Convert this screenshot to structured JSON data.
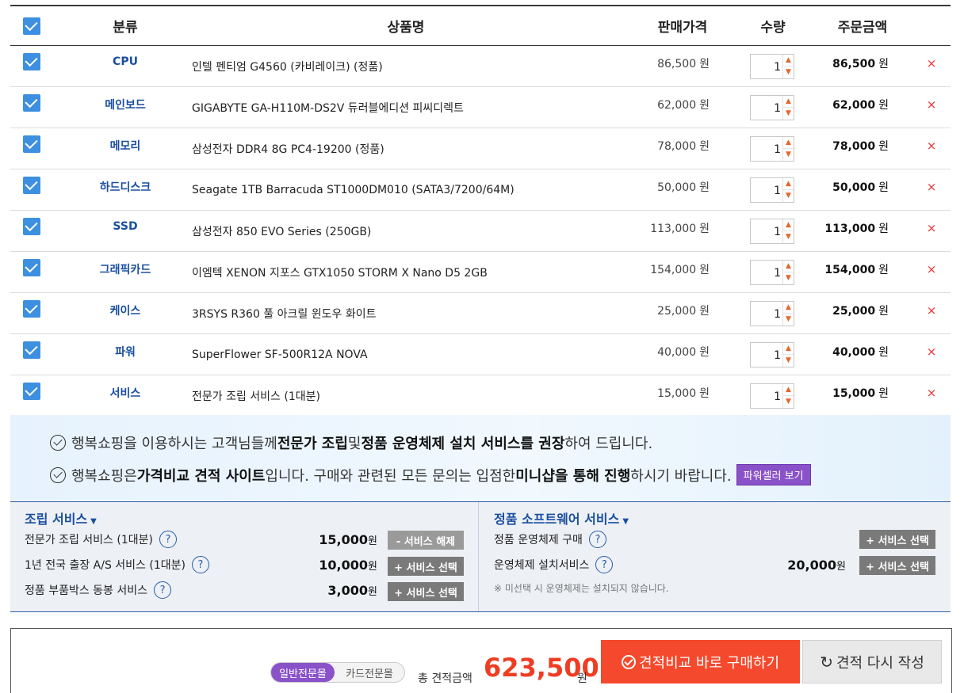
{
  "header": {
    "category": "분류",
    "product": "상품명",
    "price": "판매가격",
    "qty": "수량",
    "total": "주문금액"
  },
  "currency": "원",
  "items": [
    {
      "category": "CPU",
      "name": "인텔 펜티엄 G4560 (카비레이크) (정품)",
      "price": "86,500",
      "qty": "1",
      "total": "86,500"
    },
    {
      "category": "메인보드",
      "name": "GIGABYTE GA-H110M-DS2V 듀러블에디션 피씨디렉트",
      "price": "62,000",
      "qty": "1",
      "total": "62,000"
    },
    {
      "category": "메모리",
      "name": "삼성전자 DDR4 8G PC4-19200 (정품)",
      "price": "78,000",
      "qty": "1",
      "total": "78,000"
    },
    {
      "category": "하드디스크",
      "name": "Seagate 1TB Barracuda ST1000DM010 (SATA3/7200/64M)",
      "price": "50,000",
      "qty": "1",
      "total": "50,000"
    },
    {
      "category": "SSD",
      "name": "삼성전자 850 EVO Series (250GB)",
      "price": "113,000",
      "qty": "1",
      "total": "113,000"
    },
    {
      "category": "그래픽카드",
      "name": "이엠텍 XENON 지포스 GTX1050 STORM X Nano D5 2GB",
      "price": "154,000",
      "qty": "1",
      "total": "154,000"
    },
    {
      "category": "케이스",
      "name": "3RSYS R360 풀 아크릴 윈도우 화이트",
      "price": "25,000",
      "qty": "1",
      "total": "25,000"
    },
    {
      "category": "파워",
      "name": "SuperFlower SF-500R12A NOVA",
      "price": "40,000",
      "qty": "1",
      "total": "40,000"
    },
    {
      "category": "서비스",
      "name": "전문가 조립 서비스 (1대분)",
      "price": "15,000",
      "qty": "1",
      "total": "15,000"
    }
  ],
  "icons": {
    "check": "checkbox-checked-icon",
    "delete": "close-icon",
    "qty_up": "chevron-up-icon",
    "qty_down": "chevron-down-icon"
  },
  "delete_glyph": "×",
  "notice": {
    "line1": {
      "pre": "행복쇼핑을 이용하시는 고객님들께 ",
      "b1": "전문가 조립",
      "mid": " 및 ",
      "b2": "정품 운영체제 설치 서비스를 권장",
      "post": "하여 드립니다."
    },
    "line2": {
      "pre": "행복쇼핑은 ",
      "b1": "가격비교 견적 사이트",
      "mid": "입니다. 구매와 관련된 모든 문의는 입점한 ",
      "b2": "미니샵을 통해 진행",
      "post": "하시기 바랍니다.",
      "button": "파워셀러 보기"
    }
  },
  "assembly": {
    "title": "조립 서비스",
    "rows": [
      {
        "label": "전문가 조립 서비스 (1대분)",
        "price": "15,000",
        "button": "- 서비스 해제"
      },
      {
        "label": "1년 전국 출장 A/S 서비스 (1대분)",
        "price": "10,000",
        "button": "+ 서비스 선택"
      },
      {
        "label": "정품 부품박스 동봉 서비스",
        "price": "3,000",
        "button": "+ 서비스 선택"
      }
    ]
  },
  "software": {
    "title": "정품 소프트웨어 서비스",
    "rows": [
      {
        "label": "정품 운영체제 구매",
        "price": "",
        "button": "+ 서비스 선택"
      },
      {
        "label": "운영체제 설치서비스",
        "price": "20,000",
        "button": "+ 서비스 선택"
      }
    ],
    "note": "※ 미선택 시 운영체제는 설치되지 않습니다."
  },
  "summary": {
    "toggle_on": "일반전문몰",
    "toggle_off": "카드전문몰",
    "total_label": "총 견적금액",
    "total_amount": "623,500",
    "buy_label": "견적비교 바로 구매하기",
    "reset_label": "견적 다시 작성",
    "reset_glyph": "↻"
  },
  "colors": {
    "accent": "#3d8fe0",
    "brand_red": "#f4492c",
    "purple": "#8a52c8",
    "category_blue": "#1a4fa0"
  }
}
